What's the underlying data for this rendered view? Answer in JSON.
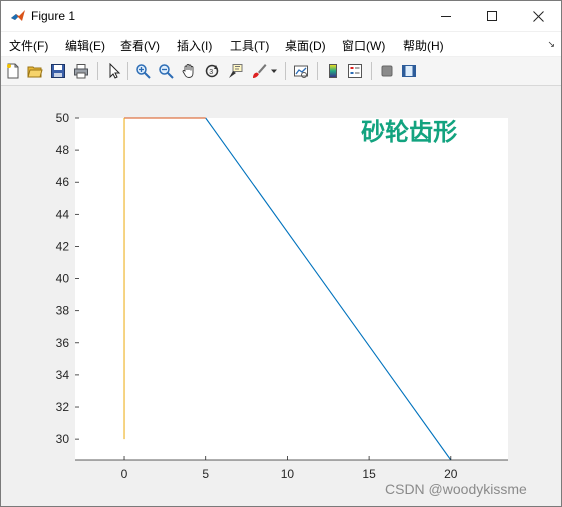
{
  "window": {
    "title": "Figure 1",
    "minimize_label": "—",
    "close_label": "✕"
  },
  "menu": {
    "items": [
      "文件(F)",
      "编辑(E)",
      "查看(V)",
      "插入(I)",
      "工具(T)",
      "桌面(D)",
      "窗口(W)",
      "帮助(H)"
    ]
  },
  "toolbar": {
    "icons": [
      "new-figure-icon",
      "open-file-icon",
      "save-icon",
      "print-icon",
      "pointer-icon",
      "zoom-in-icon",
      "zoom-out-icon",
      "pan-hand-icon",
      "rotate-3d-icon",
      "data-cursor-icon",
      "brush-icon",
      "link-plot-icon",
      "colorbar-icon",
      "legend-icon",
      "hide-plot-tools-icon",
      "show-plot-tools-icon"
    ]
  },
  "colors": {
    "blue": "#0072BD",
    "orange": "#D95319",
    "yellow": "#EDB120",
    "annotation": "#12A37F",
    "axes_bg": "#ffffff",
    "figure_bg": "#f0f0f0"
  },
  "chart_data": {
    "type": "line",
    "title": "",
    "xlabel": "",
    "ylabel": "",
    "xlim": [
      -3,
      23.5
    ],
    "ylim": [
      28.7,
      50
    ],
    "xticks": [
      0,
      5,
      10,
      15,
      20
    ],
    "yticks": [
      30,
      32,
      34,
      36,
      38,
      40,
      42,
      44,
      46,
      48,
      50
    ],
    "grid": false,
    "series": [
      {
        "color": "#0072BD",
        "x": [
          5,
          20
        ],
        "y": [
          50,
          28.7
        ]
      },
      {
        "color": "#D95319",
        "x": [
          0,
          5
        ],
        "y": [
          50,
          50
        ]
      },
      {
        "color": "#EDB120",
        "x": [
          0,
          0
        ],
        "y": [
          30,
          50
        ]
      }
    ],
    "annotations": [
      {
        "text": "砂轮齿形",
        "x": 15,
        "y": 49,
        "color": "#12A37F"
      }
    ]
  },
  "watermark": "CSDN @woodykissme"
}
